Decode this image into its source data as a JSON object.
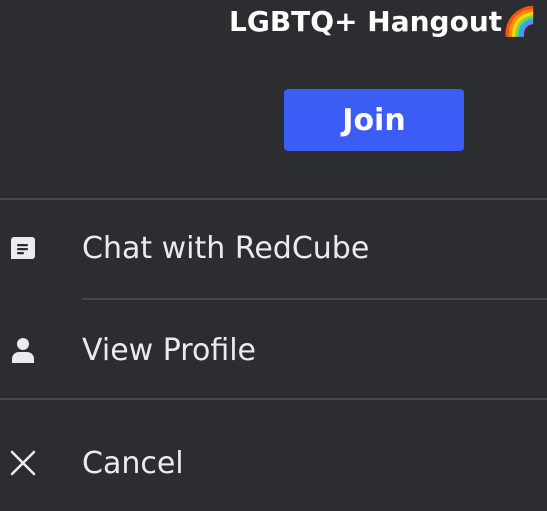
{
  "header": {
    "title": "LGBTQ+ Hangout🌈"
  },
  "actions": {
    "join_label": "Join"
  },
  "menu": {
    "items": [
      {
        "label": "Chat with RedCube",
        "icon": "chat-bubble-icon"
      },
      {
        "label": "View Profile",
        "icon": "person-icon"
      },
      {
        "label": "Cancel",
        "icon": "close-icon"
      }
    ]
  },
  "colors": {
    "background": "#2b2d31",
    "accent": "#3c5cf6",
    "divider": "#45484f",
    "text": "#eaebee"
  }
}
